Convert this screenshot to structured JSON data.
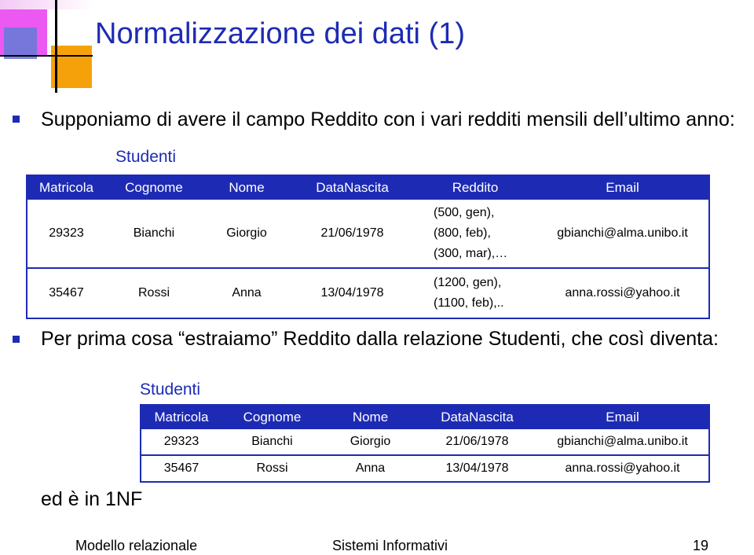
{
  "slide": {
    "title": "Normalizzazione dei dati (1)",
    "bullet1": "Supponiamo di avere il campo Reddito con i vari redditi mensili dell’ultimo anno:",
    "bullet2": "Per prima cosa “estraiamo” Reddito dalla relazione Studenti, che così diventa:",
    "conclusion": "ed è in 1NF"
  },
  "table1": {
    "caption": "Studenti",
    "headers": [
      "Matricola",
      "Cognome",
      "Nome",
      "DataNascita",
      "Reddito",
      "Email"
    ],
    "rows": [
      {
        "matricola": "29323",
        "cognome": "Bianchi",
        "nome": "Giorgio",
        "data": "21/06/1978",
        "reddito": [
          "(500, gen),",
          "(800, feb),",
          "(300, mar),…"
        ],
        "email": "gbianchi@alma.unibo.it"
      },
      {
        "matricola": "35467",
        "cognome": "Rossi",
        "nome": "Anna",
        "data": "13/04/1978",
        "reddito": [
          "(1200, gen),",
          "(1100, feb),.."
        ],
        "email": "anna.rossi@yahoo.it"
      }
    ]
  },
  "table2": {
    "caption": "Studenti",
    "headers": [
      "Matricola",
      "Cognome",
      "Nome",
      "DataNascita",
      "Email"
    ],
    "rows": [
      [
        "29323",
        "Bianchi",
        "Giorgio",
        "21/06/1978",
        "gbianchi@alma.unibo.it"
      ],
      [
        "35467",
        "Rossi",
        "Anna",
        "13/04/1978",
        "anna.rossi@yahoo.it"
      ]
    ]
  },
  "footer": {
    "left": "Modello relazionale",
    "center": "Sistemi Informativi",
    "page": "19"
  },
  "colors": {
    "accent": "#1d2bb4",
    "logo_magenta": "#e83cf0",
    "logo_orange": "#f5a20a"
  }
}
